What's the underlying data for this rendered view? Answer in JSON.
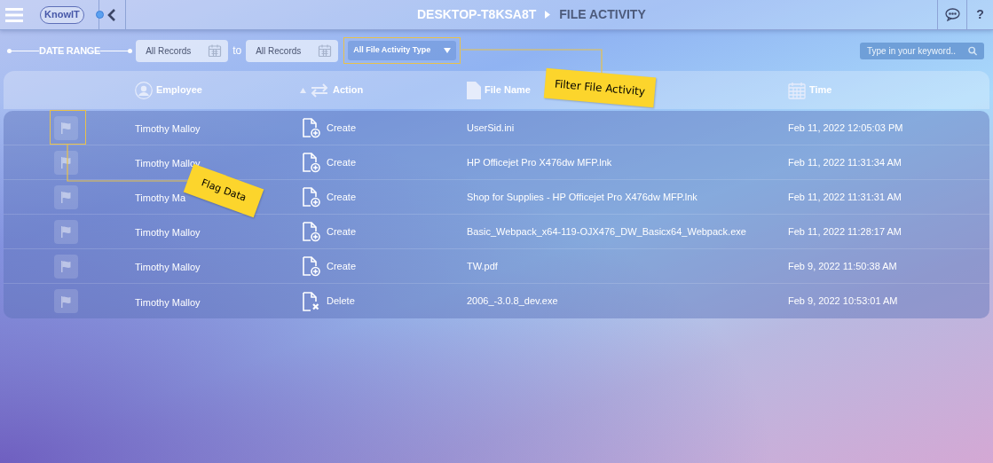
{
  "header": {
    "logo": "KnowIT",
    "breadcrumb": [
      "DESKTOP-T8KSA8T",
      "FILE ACTIVITY"
    ],
    "help": "?"
  },
  "filters": {
    "date_range_label": "DATE RANGE",
    "from": "All Records",
    "to_label": "to",
    "to": "All Records",
    "activity_type": "All File Activity Type",
    "search": {
      "placeholder": "Type in your keyword.."
    }
  },
  "table": {
    "columns": [
      "Employee",
      "Action",
      "File Name",
      "Time"
    ],
    "rows": [
      {
        "employee": "Timothy Malloy",
        "action": "Create",
        "kind": "create",
        "file": "UserSid.ini",
        "time": "Feb 11, 2022 12:05:03 PM"
      },
      {
        "employee": "Timothy Malloy",
        "action": "Create",
        "kind": "create",
        "file": "HP Officejet Pro X476dw MFP.lnk",
        "time": "Feb 11, 2022 11:31:34 AM"
      },
      {
        "employee": "Timothy Ma",
        "action": "Create",
        "kind": "create",
        "file": "Shop for Supplies - HP Officejet Pro X476dw MFP.lnk",
        "time": "Feb 11, 2022 11:31:31 AM"
      },
      {
        "employee": "Timothy Malloy",
        "action": "Create",
        "kind": "create",
        "file": "Basic_Webpack_x64-119-OJX476_DW_Basicx64_Webpack.exe",
        "time": "Feb 11, 2022 11:28:17 AM"
      },
      {
        "employee": "Timothy Malloy",
        "action": "Create",
        "kind": "create",
        "file": "TW.pdf",
        "time": "Feb 9, 2022 11:50:38 AM"
      },
      {
        "employee": "Timothy Malloy",
        "action": "Delete",
        "kind": "delete",
        "file": "2006_-3.0.8_dev.exe",
        "time": "Feb 9, 2022 10:53:01 AM"
      }
    ]
  },
  "callouts": [
    {
      "text": "Filter File Activity"
    },
    {
      "text": "Flag Data"
    }
  ]
}
